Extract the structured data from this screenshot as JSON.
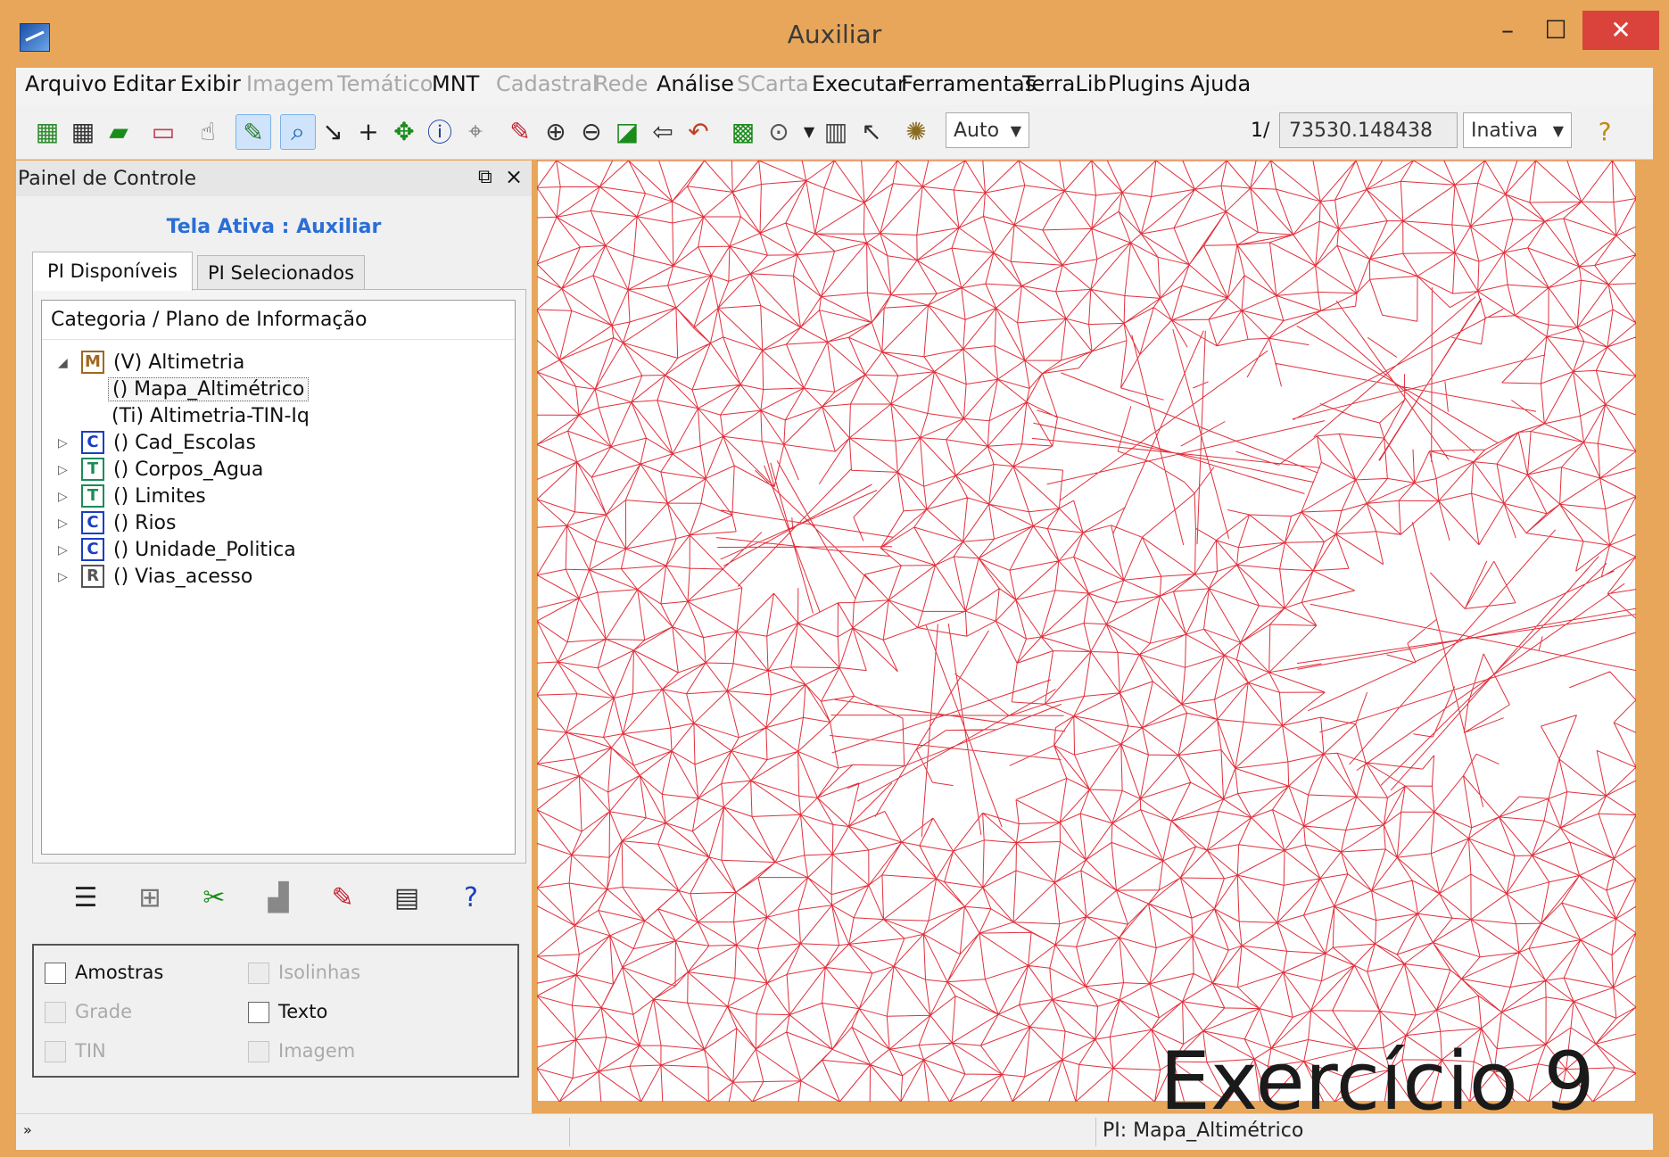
{
  "window": {
    "title": "Auxiliar",
    "minimize": "–",
    "maximize": "☐",
    "close": "✕"
  },
  "menu": [
    {
      "label": "Arquivo",
      "enabled": true
    },
    {
      "label": "Editar",
      "enabled": true
    },
    {
      "label": "Exibir",
      "enabled": true
    },
    {
      "label": "Imagem",
      "enabled": false
    },
    {
      "label": "Temático",
      "enabled": false
    },
    {
      "label": "MNT",
      "enabled": true
    },
    {
      "label": "Cadastral",
      "enabled": false
    },
    {
      "label": "Rede",
      "enabled": false
    },
    {
      "label": "Análise",
      "enabled": true
    },
    {
      "label": "SCarta",
      "enabled": false
    },
    {
      "label": "Executar",
      "enabled": true
    },
    {
      "label": "Ferramentas",
      "enabled": true
    },
    {
      "label": "TerraLib",
      "enabled": true
    },
    {
      "label": "Plugins",
      "enabled": true
    },
    {
      "label": "Ajuda",
      "enabled": true
    }
  ],
  "toolbar": {
    "display_mode": "Auto",
    "scale_prefix": "1/",
    "scale_value": "73530.148438",
    "state": "Inativa"
  },
  "panel": {
    "title": "Painel de Controle",
    "active_screen": "Tela Ativa : Auxiliar",
    "tabs": [
      "PI Disponíveis",
      "PI Selecionados"
    ],
    "tree_header": "Categoria / Plano de Informação",
    "tree": [
      {
        "icon": "M",
        "label": "(V) Altimetria",
        "expanded": true
      },
      {
        "label": "() Mapa_Altimétrico",
        "child": true,
        "selected": true
      },
      {
        "label": "(Ti) Altimetria-TIN-Iq",
        "child": true
      },
      {
        "icon": "C",
        "label": "() Cad_Escolas"
      },
      {
        "icon": "T",
        "label": "() Corpos_Agua"
      },
      {
        "icon": "T",
        "label": "() Limites"
      },
      {
        "icon": "C",
        "label": "() Rios"
      },
      {
        "icon": "C",
        "label": "() Unidade_Politica"
      },
      {
        "icon": "R",
        "label": "() Vias_acesso"
      }
    ],
    "options": [
      {
        "label": "Amostras",
        "enabled": true
      },
      {
        "label": "Isolinhas",
        "enabled": false
      },
      {
        "label": "Grade",
        "enabled": false
      },
      {
        "label": "Texto",
        "enabled": true
      },
      {
        "label": "TIN",
        "enabled": false
      },
      {
        "label": "Imagem",
        "enabled": false
      }
    ]
  },
  "status": {
    "pi": "PI: Mapa_Altimétrico",
    "arrow": "»"
  },
  "watermark": "Exercício 9",
  "colors": {
    "title_bar": "#e8a65a",
    "tin_lines": "#e0303c",
    "active_screen_text": "#2a6ed6",
    "close_button": "#d9433b"
  }
}
